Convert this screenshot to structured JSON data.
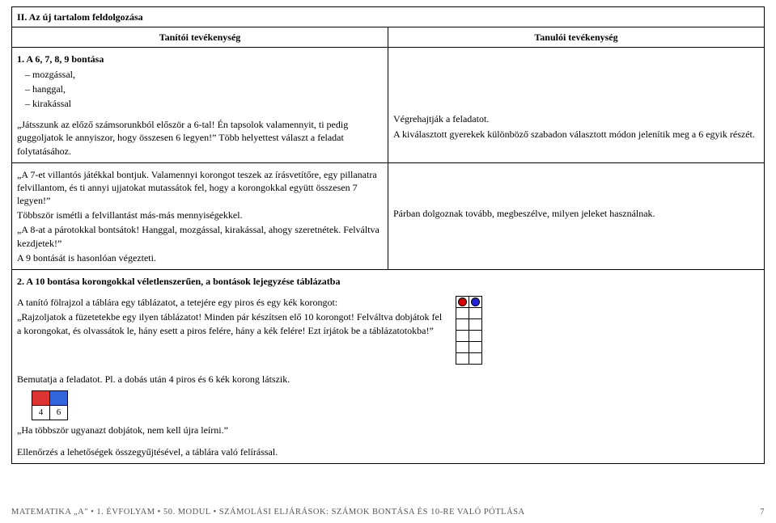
{
  "section_header": "II. Az új tartalom feldolgozása",
  "col_header_left": "Tanítói tevékenység",
  "col_header_right": "Tanulói tevékenység",
  "row1": {
    "title": "1.  A 6, 7, 8, 9 bontása",
    "bullets": [
      "mozgással,",
      "hanggal,",
      "kirakással"
    ],
    "p1": "„Játsszunk az előző számsorunkból először a 6-tal! Én tapsolok valamennyit, ti pedig guggoljatok le annyiszor, hogy összesen 6 legyen!” Több helyettest választ a feladat folytatásához.",
    "right1": "Végrehajtják a feladatot.",
    "right2": "A kiválasztott gyerekek különböző szabadon választott módon jelenítik meg a 6 egyik részét."
  },
  "row2": {
    "p1": "„A 7-et villantós játékkal bontjuk. Valamennyi korongot teszek az írásvetítőre, egy pillanatra felvillantom, és ti annyi ujjatokat mutassátok fel, hogy a korongokkal együtt összesen 7 legyen!”",
    "p2": "Többször ismétli a felvillantást más-más mennyiségekkel.",
    "p3": "„A 8-at a párotokkal bontsátok! Hanggal, mozgással, kirakással, ahogy szeretnétek. Felváltva kezdjetek!”",
    "p4": "A 9 bontását is hasonlóan végezteti.",
    "right": "Párban dolgoznak tovább, megbeszélve, milyen jeleket használnak."
  },
  "row3": {
    "title": "2.  A 10 bontása korongokkal véletlenszerűen, a bontások lejegyzése táblázatba",
    "p1": "A tanító fölrajzol a táblára egy táblázatot, a tetejére egy piros és egy kék korongot:",
    "p2": "„Rajzoljatok a füzetetekbe egy ilyen táblázatot! Minden pár készítsen elő 10 korongot! Felváltva dobjátok fel a korongokat, és olvassátok le, hány esett a piros felére, hány a kék felére! Ezt írjátok be a táblázatotokba!”",
    "p3": "Bemutatja a feladatot. Pl. a dobás után 4 piros és 6 kék korong látszik.",
    "p4": "„Ha többször ugyanazt dobjátok, nem kell újra leírni.”",
    "p5": "Ellenőrzés a lehetőségek összegyűjtésével, a táblára való felírással.",
    "val_a": "4",
    "val_b": "6"
  },
  "footer_left": "MATEMATIKA „A\" • 1. ÉVFOLYAM • 50. MODUL • SZÁMOLÁSI ELJÁRÁSOK: SZÁMOK BONTÁSA ÉS 10-RE VALÓ PÓTLÁSA",
  "page_number": "7"
}
